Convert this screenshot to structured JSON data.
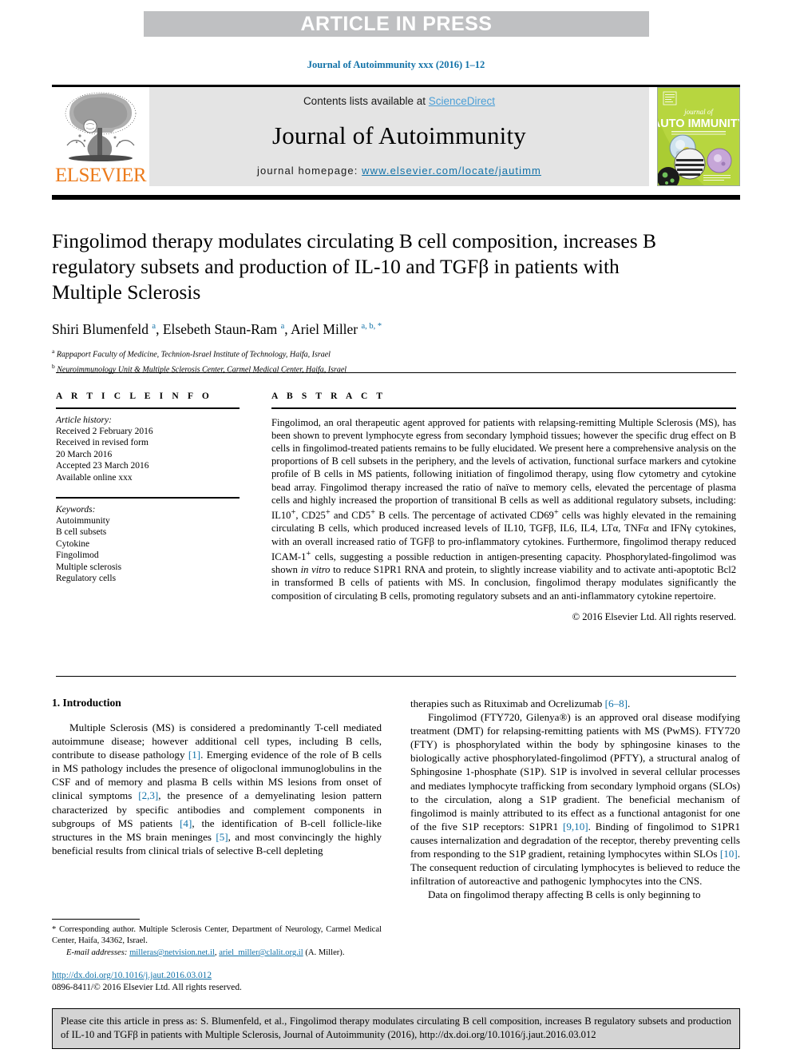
{
  "banner": {
    "label": "ARTICLE IN PRESS"
  },
  "running_head": "Journal of Autoimmunity xxx (2016) 1–12",
  "masthead": {
    "contents_prefix": "Contents lists available at ",
    "sciencedirect": "ScienceDirect",
    "journal_name": "Journal of Autoimmunity",
    "homepage_prefix": "journal homepage: ",
    "homepage_url": "www.elsevier.com/locate/jautimm",
    "publisher": "ELSEVIER",
    "cover": {
      "line1": "journal of",
      "line2": "AUTO IMMUNITY"
    },
    "accent_link": "#1272a8",
    "sd_link_color": "#4a9ed6",
    "elsevier_orange": "#ec7b1c",
    "cover_green": "#aacc33",
    "banner_gray": "#bfc0c2"
  },
  "article": {
    "title": "Fingolimod therapy modulates circulating B cell composition, increases B regulatory subsets and production of IL-10 and TGFβ in patients with Multiple Sclerosis",
    "authors_html": "Shiri Blumenfeld <sup>a</sup>, Elsebeth Staun-Ram <sup>a</sup>, Ariel Miller <sup>a, b, *</sup>",
    "affiliations": [
      "Rappaport Faculty of Medicine, Technion-Israel Institute of Technology, Haifa, Israel",
      "Neuroimmunology Unit & Multiple Sclerosis Center, Carmel Medical Center, Haifa, Israel"
    ],
    "affiliation_marks": [
      "a",
      "b"
    ]
  },
  "article_info": {
    "heading": "A R T I C L E    I N F O",
    "history_label": "Article history:",
    "history": [
      "Received 2 February 2016",
      "Received in revised form",
      "20 March 2016",
      "Accepted 23 March 2016",
      "Available online xxx"
    ],
    "keywords_label": "Keywords:",
    "keywords": [
      "Autoimmunity",
      "B cell subsets",
      "Cytokine",
      "Fingolimod",
      "Multiple sclerosis",
      "Regulatory cells"
    ]
  },
  "abstract": {
    "heading": "A B S T R A C T",
    "text": "Fingolimod, an oral therapeutic agent approved for patients with relapsing-remitting Multiple Sclerosis (MS), has been shown to prevent lymphocyte egress from secondary lymphoid tissues; however the specific drug effect on B cells in fingolimod-treated patients remains to be fully elucidated. We present here a comprehensive analysis on the proportions of B cell subsets in the periphery, and the levels of activation, functional surface markers and cytokine profile of B cells in MS patients, following initiation of fingolimod therapy, using flow cytometry and cytokine bead array. Fingolimod therapy increased the ratio of naïve to memory cells, elevated the percentage of plasma cells and highly increased the proportion of transitional B cells as well as additional regulatory subsets, including: IL10+, CD25+ and CD5+ B cells. The percentage of activated CD69+ cells was highly elevated in the remaining circulating B cells, which produced increased levels of IL10, TGFβ, IL6, IL4, LTα, TNFα and IFNγ cytokines, with an overall increased ratio of TGFβ to pro-inflammatory cytokines. Furthermore, fingolimod therapy reduced ICAM-1+ cells, suggesting a possible reduction in antigen-presenting capacity. Phosphorylated-fingolimod was shown in vitro to reduce S1PR1 RNA and protein, to slightly increase viability and to activate anti-apoptotic Bcl2 in transformed B cells of patients with MS. In conclusion, fingolimod therapy modulates significantly the composition of circulating B cells, promoting regulatory subsets and an anti-inflammatory cytokine repertoire.",
    "copyright": "© 2016 Elsevier Ltd. All rights reserved."
  },
  "introduction": {
    "heading": "1. Introduction",
    "left_paragraph": "Multiple Sclerosis (MS) is considered a predominantly T-cell mediated autoimmune disease; however additional cell types, including B cells, contribute to disease pathology [1]. Emerging evidence of the role of B cells in MS pathology includes the presence of oligoclonal immunoglobulins in the CSF and of memory and plasma B cells within MS lesions from onset of clinical symptoms [2,3], the presence of a demyelinating lesion pattern characterized by specific antibodies and complement components in subgroups of MS patients [4], the identification of B-cell follicle-like structures in the MS brain meninges [5], and most convincingly the highly beneficial results from clinical trials of selective B-cell depleting",
    "right_paragraph_1": "therapies such as Rituximab and Ocrelizumab [6–8].",
    "right_paragraph_2": "Fingolimod (FTY720, Gilenya®) is an approved oral disease modifying treatment (DMT) for relapsing-remitting patients with MS (PwMS). FTY720 (FTY) is phosphorylated within the body by sphingosine kinases to the biologically active phosphorylated-fingolimod (PFTY), a structural analog of Sphingosine 1-phosphate (S1P). S1P is involved in several cellular processes and mediates lymphocyte trafficking from secondary lymphoid organs (SLOs) to the circulation, along a S1P gradient. The beneficial mechanism of fingolimod is mainly attributed to its effect as a functional antagonist for one of the five S1P receptors: S1PR1 [9,10]. Binding of fingolimod to S1PR1 causes internalization and degradation of the receptor, thereby preventing cells from responding to the S1P gradient, retaining lymphocytes within SLOs [10]. The consequent reduction of circulating lymphocytes is believed to reduce the infiltration of autoreactive and pathogenic lymphocytes into the CNS.",
    "right_paragraph_3": "Data on fingolimod therapy affecting B cells is only beginning to"
  },
  "footnotes": {
    "corresponding": "* Corresponding author. Multiple Sclerosis Center, Department of Neurology, Carmel Medical Center, Haifa, 34362, Israel.",
    "email_label": "E-mail addresses:",
    "email_1": "milleras@netvision.net.il",
    "email_2": "ariel_miller@clalit.org.il",
    "email_suffix": "(A. Miller).",
    "doi_url": "http://dx.doi.org/10.1016/j.jaut.2016.03.012",
    "issn_line": "0896-8411/© 2016 Elsevier Ltd. All rights reserved."
  },
  "cite_box": {
    "text": "Please cite this article in press as: S. Blumenfeld, et al., Fingolimod therapy modulates circulating B cell composition, increases B regulatory subsets and production of IL-10 and TGFβ in patients with Multiple Sclerosis, Journal of Autoimmunity (2016), http://dx.doi.org/10.1016/j.jaut.2016.03.012"
  }
}
